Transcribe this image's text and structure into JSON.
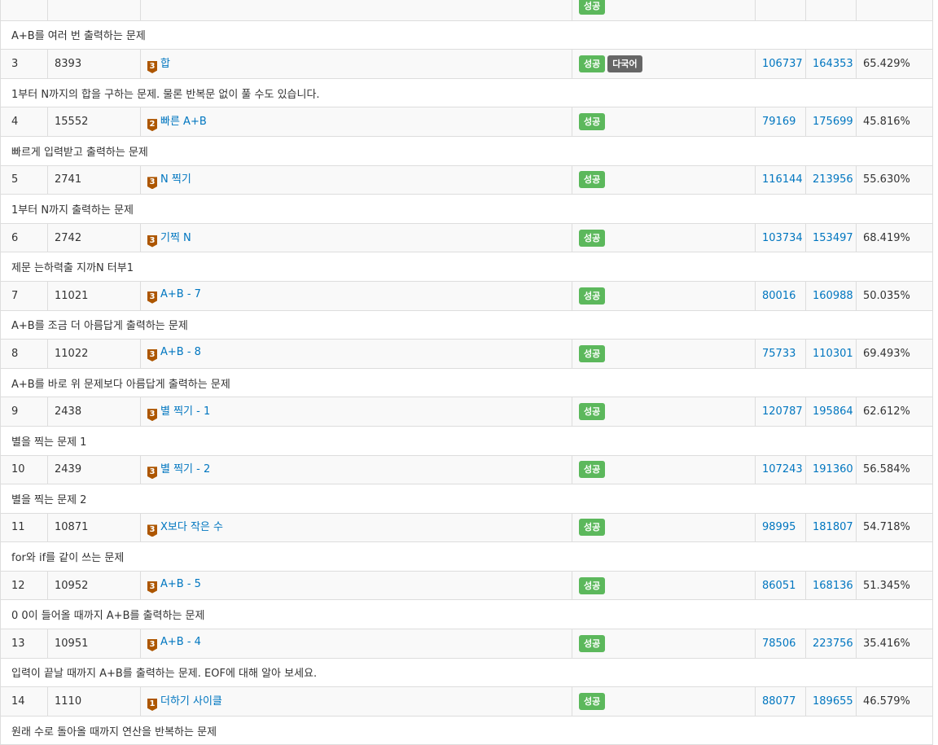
{
  "colors": {
    "link": "#0076c0",
    "bronze_tier": "#ad5600",
    "success_badge": "#5cb85c",
    "multilang_badge": "#666666",
    "row_stripe": "#f9f9f9",
    "border": "#dddddd"
  },
  "problems": [
    {
      "no": "",
      "id": "",
      "tier_icon": "bronze-tier-icon",
      "tier": "",
      "title": "",
      "badges": [
        "성공"
      ],
      "solved": "",
      "submit": "",
      "ratio": "",
      "desc": "A+B를 여러 번 출력하는 문제"
    },
    {
      "no": "3",
      "id": "8393",
      "tier_icon": "bronze-tier-icon",
      "tier": "3",
      "title": "합",
      "badges": [
        "성공",
        "다국어"
      ],
      "solved": "106737",
      "submit": "164353",
      "ratio": "65.429%",
      "desc": "1부터 N까지의 합을 구하는 문제. 물론 반복문 없이 풀 수도 있습니다."
    },
    {
      "no": "4",
      "id": "15552",
      "tier_icon": "bronze-tier-icon",
      "tier": "2",
      "title": "빠른 A+B",
      "badges": [
        "성공"
      ],
      "solved": "79169",
      "submit": "175699",
      "ratio": "45.816%",
      "desc": "빠르게 입력받고 출력하는 문제"
    },
    {
      "no": "5",
      "id": "2741",
      "tier_icon": "bronze-tier-icon",
      "tier": "3",
      "title": "N 찍기",
      "badges": [
        "성공"
      ],
      "solved": "116144",
      "submit": "213956",
      "ratio": "55.630%",
      "desc": "1부터 N까지 출력하는 문제"
    },
    {
      "no": "6",
      "id": "2742",
      "tier_icon": "bronze-tier-icon",
      "tier": "3",
      "title": "기찍 N",
      "badges": [
        "성공"
      ],
      "solved": "103734",
      "submit": "153497",
      "ratio": "68.419%",
      "desc": "제문 는하력출 지까N 터부1"
    },
    {
      "no": "7",
      "id": "11021",
      "tier_icon": "bronze-tier-icon",
      "tier": "3",
      "title": "A+B - 7",
      "badges": [
        "성공"
      ],
      "solved": "80016",
      "submit": "160988",
      "ratio": "50.035%",
      "desc": "A+B를 조금 더 아름답게 출력하는 문제"
    },
    {
      "no": "8",
      "id": "11022",
      "tier_icon": "bronze-tier-icon",
      "tier": "3",
      "title": "A+B - 8",
      "badges": [
        "성공"
      ],
      "solved": "75733",
      "submit": "110301",
      "ratio": "69.493%",
      "desc": "A+B를 바로 위 문제보다 아름답게 출력하는 문제"
    },
    {
      "no": "9",
      "id": "2438",
      "tier_icon": "bronze-tier-icon",
      "tier": "3",
      "title": "별 찍기 - 1",
      "badges": [
        "성공"
      ],
      "solved": "120787",
      "submit": "195864",
      "ratio": "62.612%",
      "desc": "별을 찍는 문제 1"
    },
    {
      "no": "10",
      "id": "2439",
      "tier_icon": "bronze-tier-icon",
      "tier": "3",
      "title": "별 찍기 - 2",
      "badges": [
        "성공"
      ],
      "solved": "107243",
      "submit": "191360",
      "ratio": "56.584%",
      "desc": "별을 찍는 문제 2"
    },
    {
      "no": "11",
      "id": "10871",
      "tier_icon": "bronze-tier-icon",
      "tier": "3",
      "title": "X보다 작은 수",
      "badges": [
        "성공"
      ],
      "solved": "98995",
      "submit": "181807",
      "ratio": "54.718%",
      "desc": "for와 if를 같이 쓰는 문제"
    },
    {
      "no": "12",
      "id": "10952",
      "tier_icon": "bronze-tier-icon",
      "tier": "3",
      "title": "A+B - 5",
      "badges": [
        "성공"
      ],
      "solved": "86051",
      "submit": "168136",
      "ratio": "51.345%",
      "desc": "0 0이 들어올 때까지 A+B를 출력하는 문제"
    },
    {
      "no": "13",
      "id": "10951",
      "tier_icon": "bronze-tier-icon",
      "tier": "3",
      "title": "A+B - 4",
      "badges": [
        "성공"
      ],
      "solved": "78506",
      "submit": "223756",
      "ratio": "35.416%",
      "desc": "입력이 끝날 때까지 A+B를 출력하는 문제. EOF에 대해 알아 보세요."
    },
    {
      "no": "14",
      "id": "1110",
      "tier_icon": "bronze-tier-icon",
      "tier": "1",
      "title": "더하기 사이클",
      "badges": [
        "성공"
      ],
      "solved": "88077",
      "submit": "189655",
      "ratio": "46.579%",
      "desc": "원래 수로 돌아올 때까지 연산을 반복하는 문제"
    }
  ]
}
